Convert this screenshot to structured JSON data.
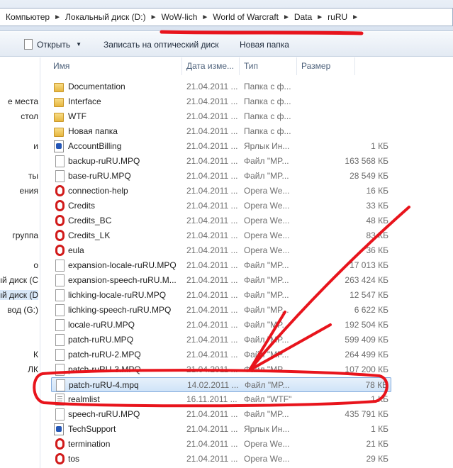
{
  "address": {
    "crumbs": [
      "Компьютер",
      "Локальный диск (D:)",
      "WoW-lich",
      "World of Warcraft",
      "Data",
      "ruRU"
    ]
  },
  "toolbar": {
    "open_label": "Открыть",
    "burn_label": "Записать на оптический диск",
    "new_folder_label": "Новая папка"
  },
  "nav": {
    "items": [
      "е места",
      "стол",
      "и",
      "ты",
      "ения",
      "группа",
      "о",
      "ый диск (C",
      "ый диск (D",
      "вод (G:)",
      "К",
      "ЛК"
    ]
  },
  "columns": {
    "name": "Имя",
    "date": "Дата изме...",
    "type": "Тип",
    "size": "Размер"
  },
  "files": [
    {
      "name": "Documentation",
      "date": "21.04.2011 ...",
      "type": "Папка с ф...",
      "size": "",
      "icon": "folder-icon"
    },
    {
      "name": "Interface",
      "date": "21.04.2011 ...",
      "type": "Папка с ф...",
      "size": "",
      "icon": "folder-icon"
    },
    {
      "name": "WTF",
      "date": "21.04.2011 ...",
      "type": "Папка с ф...",
      "size": "",
      "icon": "folder-icon"
    },
    {
      "name": "Новая папка",
      "date": "21.04.2011 ...",
      "type": "Папка с ф...",
      "size": "",
      "icon": "folder-icon"
    },
    {
      "name": "AccountBilling",
      "date": "21.04.2011 ...",
      "type": "Ярлык Ин...",
      "size": "1 КБ",
      "icon": "shortcut-icon"
    },
    {
      "name": "backup-ruRU.MPQ",
      "date": "21.04.2011 ...",
      "type": "Файл \"MP...",
      "size": "163 568 КБ",
      "icon": "file-icon"
    },
    {
      "name": "base-ruRU.MPQ",
      "date": "21.04.2011 ...",
      "type": "Файл \"MP...",
      "size": "28 549 КБ",
      "icon": "file-icon"
    },
    {
      "name": "connection-help",
      "date": "21.04.2011 ...",
      "type": "Opera We...",
      "size": "16 КБ",
      "icon": "opera-icon"
    },
    {
      "name": "Credits",
      "date": "21.04.2011 ...",
      "type": "Opera We...",
      "size": "33 КБ",
      "icon": "opera-icon"
    },
    {
      "name": "Credits_BC",
      "date": "21.04.2011 ...",
      "type": "Opera We...",
      "size": "48 КБ",
      "icon": "opera-icon"
    },
    {
      "name": "Credits_LK",
      "date": "21.04.2011 ...",
      "type": "Opera We...",
      "size": "83 КБ",
      "icon": "opera-icon"
    },
    {
      "name": "eula",
      "date": "21.04.2011 ...",
      "type": "Opera We...",
      "size": "36 КБ",
      "icon": "opera-icon"
    },
    {
      "name": "expansion-locale-ruRU.MPQ",
      "date": "21.04.2011 ...",
      "type": "Файл \"MP...",
      "size": "17 013 КБ",
      "icon": "file-icon"
    },
    {
      "name": "expansion-speech-ruRU.M...",
      "date": "21.04.2011 ...",
      "type": "Файл \"MP...",
      "size": "263 424 КБ",
      "icon": "file-icon"
    },
    {
      "name": "lichking-locale-ruRU.MPQ",
      "date": "21.04.2011 ...",
      "type": "Файл \"MP...",
      "size": "12 547 КБ",
      "icon": "file-icon"
    },
    {
      "name": "lichking-speech-ruRU.MPQ",
      "date": "21.04.2011 ...",
      "type": "Файл \"MP...",
      "size": "6 622 КБ",
      "icon": "file-icon"
    },
    {
      "name": "locale-ruRU.MPQ",
      "date": "21.04.2011 ...",
      "type": "Файл \"MP...",
      "size": "192 504 КБ",
      "icon": "file-icon"
    },
    {
      "name": "patch-ruRU.MPQ",
      "date": "21.04.2011 ...",
      "type": "Файл \"MP...",
      "size": "599 409 КБ",
      "icon": "file-icon"
    },
    {
      "name": "patch-ruRU-2.MPQ",
      "date": "21.04.2011 ...",
      "type": "Файл \"MP...",
      "size": "264 499 КБ",
      "icon": "file-icon"
    },
    {
      "name": "patch-ruRU-3.MPQ",
      "date": "21.04.2011 ...",
      "type": "Файл \"MP...",
      "size": "107 200 КБ",
      "icon": "file-icon"
    },
    {
      "name": "patch-ruRU-4.mpq",
      "date": "14.02.2011 ...",
      "type": "Файл \"MP...",
      "size": "78 КБ",
      "icon": "file-icon",
      "selected": true
    },
    {
      "name": "realmlist",
      "date": "16.11.2011 ...",
      "type": "Файл \"WTF\"",
      "size": "1 КБ",
      "icon": "text-file-icon"
    },
    {
      "name": "speech-ruRU.MPQ",
      "date": "21.04.2011 ...",
      "type": "Файл \"MP...",
      "size": "435 791 КБ",
      "icon": "file-icon"
    },
    {
      "name": "TechSupport",
      "date": "21.04.2011 ...",
      "type": "Ярлык Ин...",
      "size": "1 КБ",
      "icon": "shortcut-icon"
    },
    {
      "name": "termination",
      "date": "21.04.2011 ...",
      "type": "Opera We...",
      "size": "21 КБ",
      "icon": "opera-icon"
    },
    {
      "name": "tos",
      "date": "21.04.2011 ...",
      "type": "Opera We...",
      "size": "29 КБ",
      "icon": "opera-icon"
    }
  ],
  "annotation_color": "#e8141c"
}
